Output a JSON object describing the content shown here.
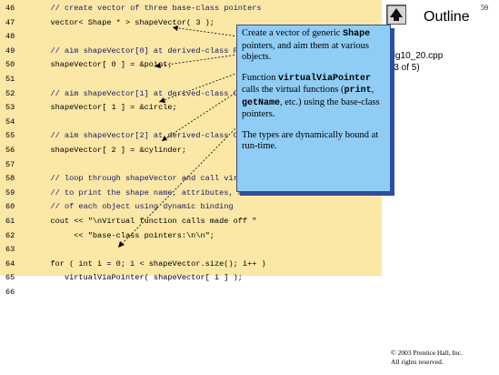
{
  "header": {
    "outline_title": "Outline",
    "page_number": "59",
    "file_label": "fig10_20.cpp\n(3 of 5)",
    "nav_icon": "up-arrow-icon"
  },
  "code": [
    {
      "num": "46",
      "code": "   // create vector of three base-class pointers"
    },
    {
      "num": "47",
      "code": "   vector< Shape * > shapeVector( 3 );"
    },
    {
      "num": "48",
      "code": ""
    },
    {
      "num": "49",
      "code": "   // aim shapeVector[0] at derived-class Point object"
    },
    {
      "num": "50",
      "code": "   shapeVector[ 0 ] = &point;"
    },
    {
      "num": "51",
      "code": ""
    },
    {
      "num": "52",
      "code": "   // aim shapeVector[1] at derived-class Circle object"
    },
    {
      "num": "53",
      "code": "   shapeVector[ 1 ] = &circle;"
    },
    {
      "num": "54",
      "code": ""
    },
    {
      "num": "55",
      "code": "   // aim shapeVector[2] at derived-class Cylinder object"
    },
    {
      "num": "56",
      "code": "   shapeVector[ 2 ] = &cylinder;"
    },
    {
      "num": "57",
      "code": ""
    },
    {
      "num": "58",
      "code": "   // loop through shapeVector and call virtualViaPointer"
    },
    {
      "num": "59",
      "code": "   // to print the shape name, attributes, area and volume"
    },
    {
      "num": "60",
      "code": "   // of each object using dynamic binding"
    },
    {
      "num": "61",
      "code": "   cout << \"\\nVirtual function calls made off \""
    },
    {
      "num": "62",
      "code": "        << \"base-class pointers:\\n\\n\";"
    },
    {
      "num": "63",
      "code": ""
    },
    {
      "num": "64",
      "code": "   for ( int i = 0; i < shapeVector.size(); i++ )"
    },
    {
      "num": "65",
      "code": "      virtualViaPointer( shapeVector[ i ] );"
    },
    {
      "num": "66",
      "code": ""
    }
  ],
  "callout": {
    "p1_a": "Create a vector of generic ",
    "p1_mono": "Shape",
    "p1_b": " pointers, and aim them at various objects.",
    "p2_a": "Function ",
    "p2_mono1": "virtualViaPointer",
    "p2_b": " calls the virtual functions (",
    "p2_mono2": "print",
    "p2_c": ", ",
    "p2_mono3": "getName",
    "p2_d": ", etc.) using the base-class pointers.",
    "p3": "The types are dynamically bound at run-time."
  },
  "footer": {
    "copyright_line1": "© 2003 Prentice Hall, Inc.",
    "copyright_line2": "All rights reserved."
  },
  "colors": {
    "code_background": "#fbe7a6",
    "callout_background": "#8fcdf5",
    "callout_shadow": "#2f4f9a"
  }
}
